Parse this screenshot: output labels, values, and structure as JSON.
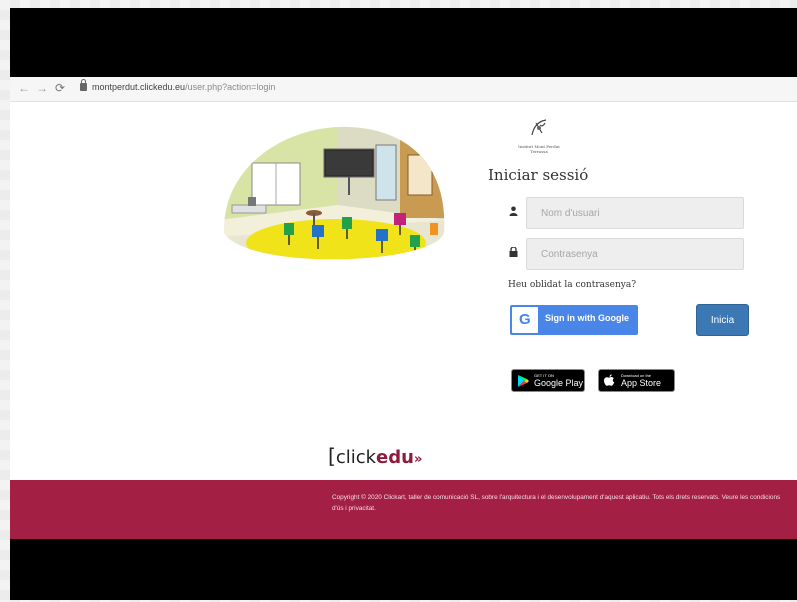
{
  "browser": {
    "back_icon": "arrow-left-icon",
    "forward_icon": "arrow-right-icon",
    "reload_icon": "reload-icon",
    "url_host": "montperdut.clickedu.eu",
    "url_path": "/user.php?action=login"
  },
  "school": {
    "logo_icon": "school-logo-icon",
    "name_line1": "Institut Mont Perdut",
    "name_line2": "Terrassa"
  },
  "login": {
    "title": "Iniciar sessió",
    "username_placeholder": "Nom d'usuari",
    "password_placeholder": "Contrasenya",
    "forgot_link": "Heu oblidat la contrasenya?",
    "google_label": "Sign in with Google",
    "google_letter": "G",
    "submit_label": "Inicia"
  },
  "stores": {
    "google_play_small": "GET IT ON",
    "google_play_big": "Google Play",
    "app_store_small": "Download on the",
    "app_store_big": "App Store"
  },
  "brand": {
    "bracket": "[",
    "click": "click",
    "edu": "edu",
    "raquo": "»"
  },
  "footer": {
    "copyright": "Copyright © 2020 Clickart, taller de comunicació SL, sobre l'arquitectura i el desenvolupament d'aquest aplicatiu. Tots els drets reservats. Veure les condicions d'ús i privacitat."
  },
  "colors": {
    "footer_bg": "#a41f44",
    "brand_accent": "#8e1a3c",
    "google_blue": "#4a86e8",
    "submit_blue": "#3c78b4"
  }
}
